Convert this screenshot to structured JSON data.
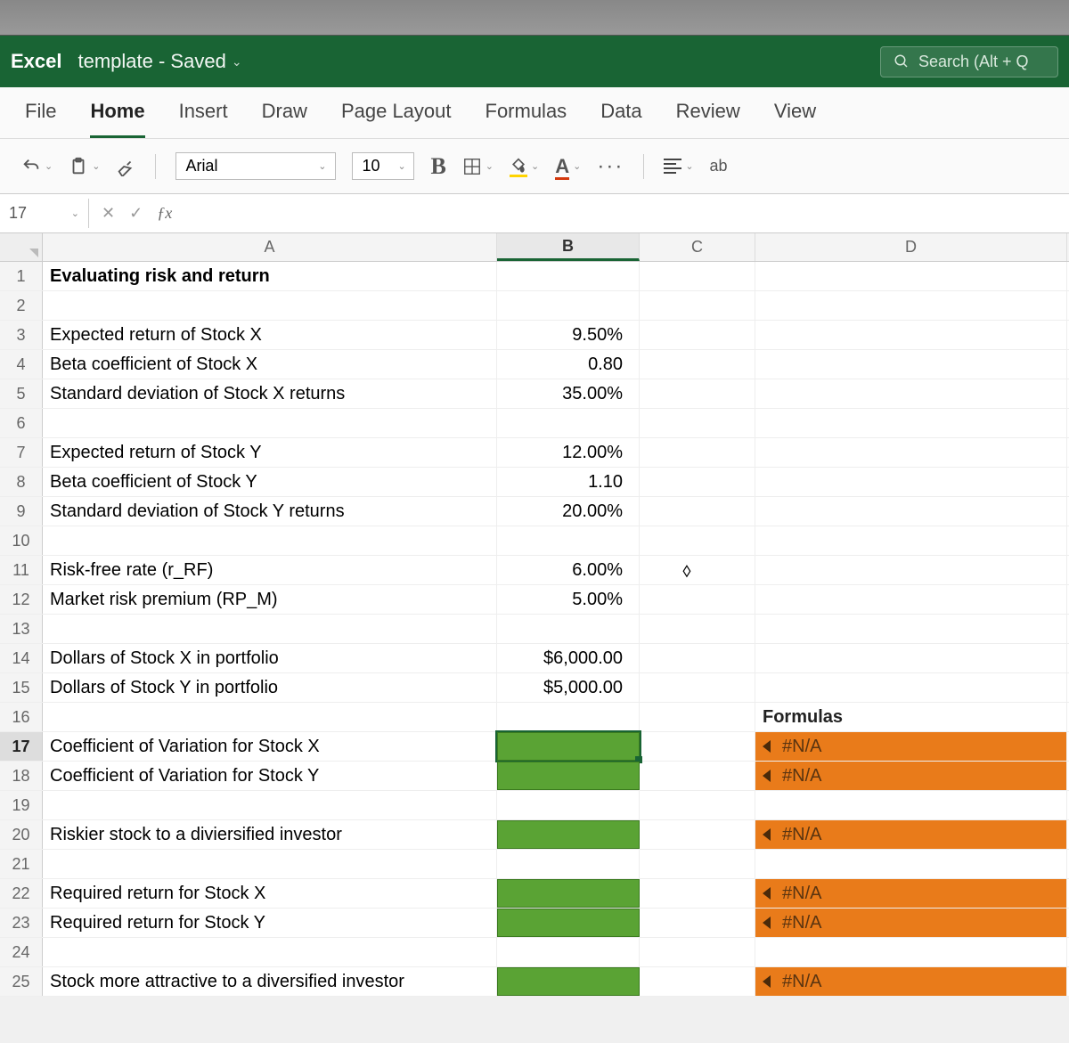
{
  "app": {
    "name": "Excel",
    "doc": "template - Saved"
  },
  "search": {
    "placeholder": "Search (Alt + Q"
  },
  "tabs": [
    "File",
    "Home",
    "Insert",
    "Draw",
    "Page Layout",
    "Formulas",
    "Data",
    "Review",
    "View"
  ],
  "active_tab": "Home",
  "toolbar": {
    "font": "Arial",
    "size": "10",
    "bold": "B",
    "font_color_letter": "A",
    "wrap_glyph": "ab"
  },
  "name_box": "17",
  "columns": [
    "A",
    "B",
    "C",
    "D"
  ],
  "formulas_header": "Formulas",
  "na_label": "#N/A",
  "rows": [
    {
      "n": "1",
      "a": "Evaluating risk and return",
      "b": "",
      "bold": true
    },
    {
      "n": "2",
      "a": "",
      "b": ""
    },
    {
      "n": "3",
      "a": "Expected return of Stock X",
      "b": "9.50%"
    },
    {
      "n": "4",
      "a": "Beta coefficient of Stock X",
      "b": "0.80"
    },
    {
      "n": "5",
      "a": "Standard deviation of Stock X returns",
      "b": "35.00%"
    },
    {
      "n": "6",
      "a": "",
      "b": ""
    },
    {
      "n": "7",
      "a": "Expected return of Stock Y",
      "b": "12.00%"
    },
    {
      "n": "8",
      "a": "Beta coefficient of Stock Y",
      "b": "1.10"
    },
    {
      "n": "9",
      "a": "Standard deviation of Stock Y returns",
      "b": "20.00%"
    },
    {
      "n": "10",
      "a": "",
      "b": ""
    },
    {
      "n": "11",
      "a": "Risk-free rate (r_RF)",
      "b": "6.00%"
    },
    {
      "n": "12",
      "a": "Market risk premium (RP_M)",
      "b": "5.00%"
    },
    {
      "n": "13",
      "a": "",
      "b": ""
    },
    {
      "n": "14",
      "a": "Dollars of Stock X in portfolio",
      "b": "$6,000.00"
    },
    {
      "n": "15",
      "a": "Dollars of Stock Y in portfolio",
      "b": "$5,000.00"
    },
    {
      "n": "16",
      "a": "",
      "b": ""
    },
    {
      "n": "17",
      "a": "Coefficient of Variation for Stock X",
      "b": "",
      "green": true,
      "orange": true,
      "selected": true
    },
    {
      "n": "18",
      "a": "Coefficient of Variation for Stock Y",
      "b": "",
      "green": true,
      "orange": true
    },
    {
      "n": "19",
      "a": "",
      "b": ""
    },
    {
      "n": "20",
      "a": "Riskier stock to a diviersified investor",
      "b": "",
      "green": true,
      "orange": true
    },
    {
      "n": "21",
      "a": "",
      "b": ""
    },
    {
      "n": "22",
      "a": "Required return for Stock X",
      "b": "",
      "green": true,
      "orange": true
    },
    {
      "n": "23",
      "a": "Required return for Stock Y",
      "b": "",
      "green": true,
      "orange": true
    },
    {
      "n": "24",
      "a": "",
      "b": ""
    },
    {
      "n": "25",
      "a": "Stock more attractive to a diversified investor",
      "b": "",
      "green": true,
      "orange": true
    }
  ]
}
